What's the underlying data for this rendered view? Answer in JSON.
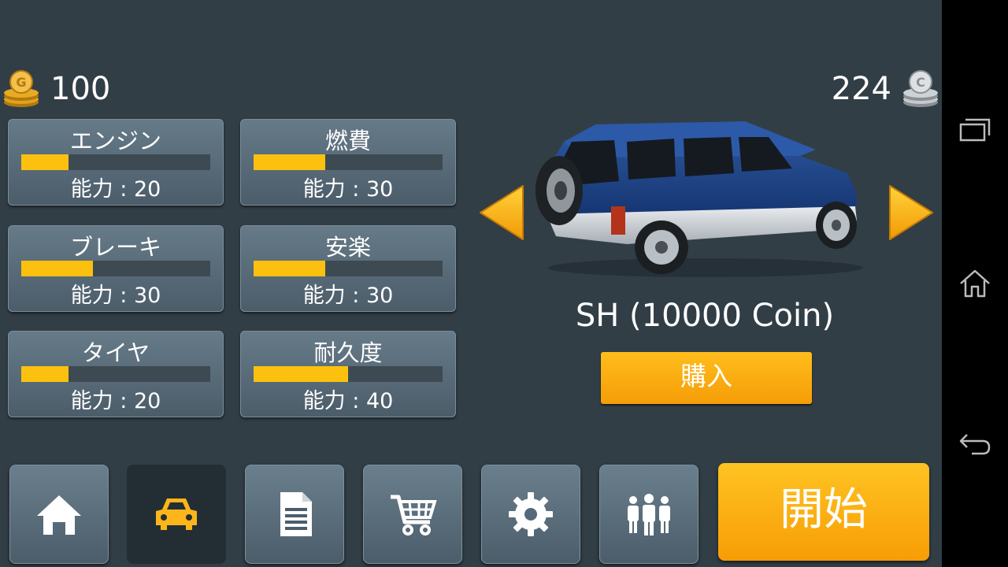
{
  "currency": {
    "gold": "100",
    "silver": "224"
  },
  "stats": [
    {
      "name": "エンジン",
      "value_label": "能力 : 20",
      "level": 0.25
    },
    {
      "name": "燃費",
      "value_label": "能力 : 30",
      "level": 0.38
    },
    {
      "name": "ブレーキ",
      "value_label": "能力 : 30",
      "level": 0.38
    },
    {
      "name": "安楽",
      "value_label": "能力 : 30",
      "level": 0.38
    },
    {
      "name": "タイヤ",
      "value_label": "能力 : 20",
      "level": 0.25
    },
    {
      "name": "耐久度",
      "value_label": "能力 : 40",
      "level": 0.5
    }
  ],
  "car": {
    "name": "SH (10000 Coin)",
    "buy_label": "購入"
  },
  "tabs": [
    {
      "icon": "home-icon"
    },
    {
      "icon": "car-icon",
      "active": true
    },
    {
      "icon": "document-icon"
    },
    {
      "icon": "cart-icon"
    },
    {
      "icon": "gear-icon"
    },
    {
      "icon": "people-icon"
    }
  ],
  "start_label": "開始",
  "colors": {
    "accent": "#fcc10f",
    "button": "#f9a60f",
    "panel": "#5b6d7a",
    "background": "#323e46"
  },
  "nav": {
    "icons": [
      "recent-apps-icon",
      "home-icon",
      "back-icon"
    ]
  }
}
